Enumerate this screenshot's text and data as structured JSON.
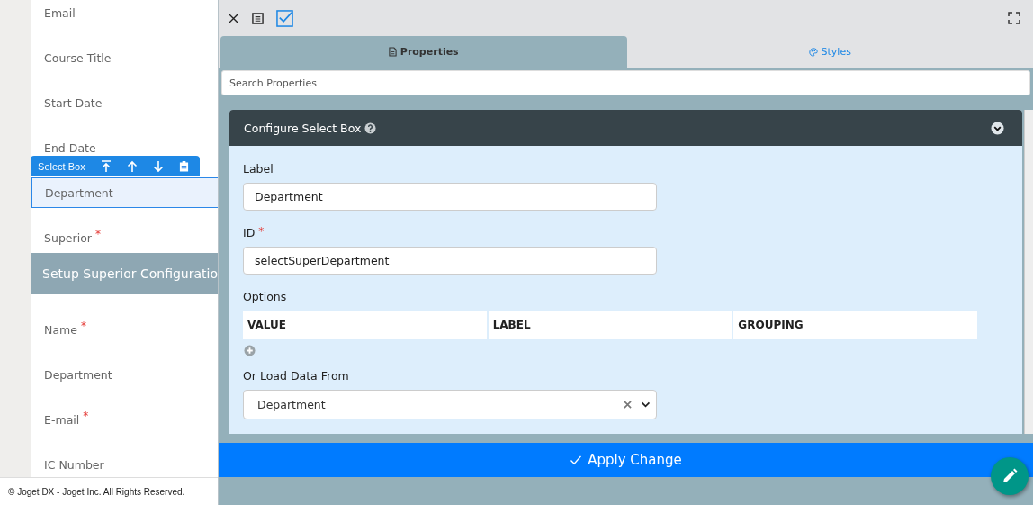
{
  "form": {
    "fields": [
      {
        "label": "Email",
        "selected": false
      },
      {
        "label": "Course Title",
        "selected": false
      },
      {
        "label": "Start Date",
        "selected": false
      },
      {
        "label": "End Date",
        "selected": false
      },
      {
        "label": "Department",
        "selected": true
      },
      {
        "label": "Superior",
        "required_mark": "*",
        "selected": false
      }
    ],
    "element_toolbar": {
      "label": "Select Box"
    },
    "section_title": "Setup Superior Configuratio",
    "section_fields": [
      {
        "label": "Name",
        "required_mark": "*",
        "selected": false
      },
      {
        "label": "Department",
        "selected": false
      },
      {
        "label": "E-mail",
        "required_mark": "*",
        "selected": false
      },
      {
        "label": "IC Number",
        "selected": false
      }
    ]
  },
  "footer": "© Joget DX - Joget Inc. All Rights Reserved.",
  "tabs": [
    {
      "label": "Properties",
      "selected": true
    },
    {
      "label": "Styles",
      "selected": false
    }
  ],
  "search": {
    "placeholder": "Search Properties"
  },
  "card": {
    "title": "Configure Select Box",
    "label_field": {
      "label": "Label",
      "value": "Department"
    },
    "id_field": {
      "label": "ID",
      "value": "selectSuperDepartment",
      "required_mark": "*"
    },
    "options": {
      "label": "Options",
      "columns": [
        "VALUE",
        "LABEL",
        "GROUPING"
      ]
    },
    "load_from": {
      "label": "Or Load Data From",
      "value": "Department"
    }
  },
  "apply_button": "Apply Change"
}
